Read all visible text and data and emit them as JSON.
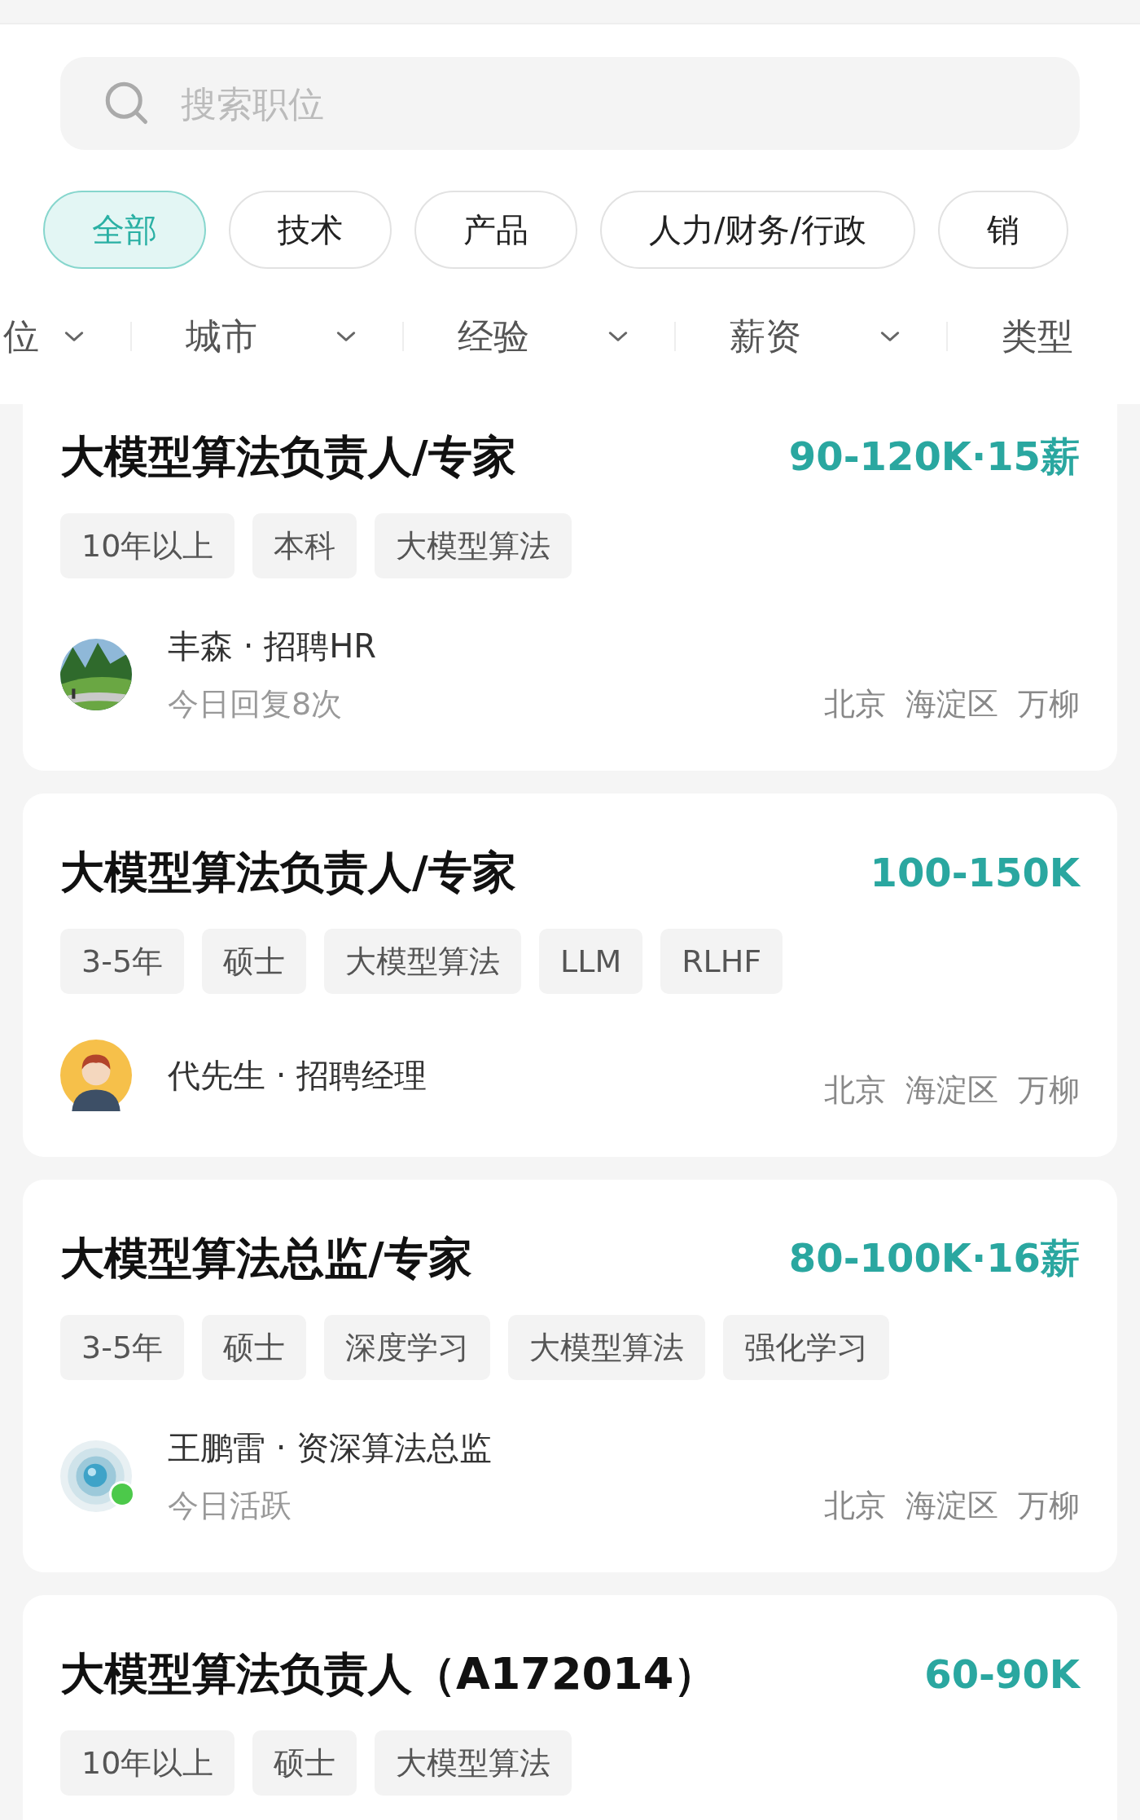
{
  "search": {
    "placeholder": "搜索职位"
  },
  "categories": [
    {
      "label": "全部",
      "selected": true
    },
    {
      "label": "技术",
      "selected": false
    },
    {
      "label": "产品",
      "selected": false
    },
    {
      "label": "人力/财务/行政",
      "selected": false
    },
    {
      "label": "销",
      "selected": false
    }
  ],
  "filters": [
    "位",
    "城市",
    "经验",
    "薪资",
    "类型"
  ],
  "jobs": [
    {
      "title": "大模型算法负责人/专家",
      "salary": "90-120K·15薪",
      "tags": [
        "10年以上",
        "本科",
        "大模型算法"
      ],
      "recruiter": {
        "online": false,
        "name": "丰森 · 招聘HR",
        "status": "今日回复8次"
      },
      "location": "北京  海淀区  万柳"
    },
    {
      "title": "大模型算法负责人/专家",
      "salary": "100-150K",
      "tags": [
        "3-5年",
        "硕士",
        "大模型算法",
        "LLM",
        "RLHF"
      ],
      "recruiter": {
        "avatar": {
          "kind": "cartoon"
        },
        "online": false,
        "name": "代先生 · 招聘经理"
      },
      "location": "北京  海淀区  万柳"
    },
    {
      "title": "大模型算法总监/专家",
      "salary": "80-100K·16薪",
      "tags": [
        "3-5年",
        "硕士",
        "深度学习",
        "大模型算法",
        "强化学习"
      ],
      "recruiter": {
        "avatar": {
          "kind": "abstract"
        },
        "online": true,
        "name": "王鹏雷 · 资深算法总监",
        "status": "今日活跃"
      },
      "location": "北京  海淀区  万柳"
    },
    {
      "title": "大模型算法负责人（A172014）",
      "salary": "60-90K",
      "tags": [
        "10年以上",
        "硕士",
        "大模型算法"
      ]
    }
  ]
}
